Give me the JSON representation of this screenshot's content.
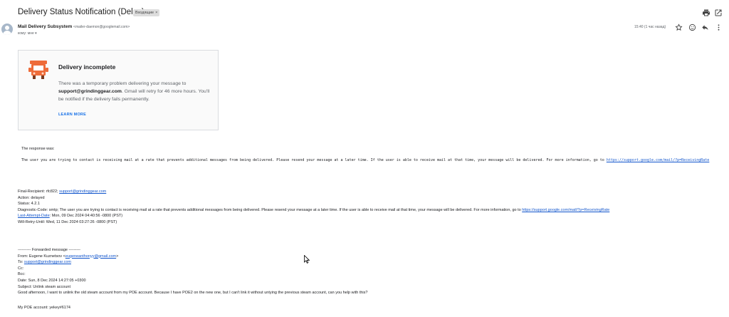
{
  "email": {
    "subject": "Delivery Status Notification (Delay)",
    "label": "Входящие",
    "label_close": "×",
    "sender_name": "Mail Delivery Subsystem",
    "sender_email": "<mailer-daemon@googlemail.com>",
    "to_line": "кому: мне",
    "time": "15:40 (1 час назад)"
  },
  "toolbar": {
    "print_icon": "print-icon",
    "open_new_icon": "open-in-new-window-icon",
    "star_icon": "star-icon",
    "emoji_icon": "emoji-icon",
    "reply_icon": "reply-icon",
    "more_icon": "more-vertical-icon"
  },
  "card": {
    "title": "Delivery incomplete",
    "text_before": "There was a temporary problem delivering your message to ",
    "recipient": "support@grindinggear.com",
    "text_after": ". Gmail will retry for 46 more hours. You'll be notified if the delivery fails permanently.",
    "learn_more": "LEARN MORE",
    "icon_color": "#ee6c3a"
  },
  "response": {
    "label": "The response was:",
    "text": "The user you are trying to contact is receiving mail at a rate that prevents additional messages from being delivered. Please resend your message at a later time. If the user is able to receive mail at that time, your message will be delivered. For more information, go to ",
    "link": "https://support.google.com/mail/?p=ReceivingRate"
  },
  "diagnostic": {
    "final_recipient_label": "Final-Recipient: rfc822; ",
    "final_recipient": "support@grindinggear.com",
    "action": "Action: delayed",
    "status": "Status: 4.2.1",
    "diag_code": "Diagnostic-Code: smtp; The user you are trying to contact is receiving mail at a rate that prevents additional messages from being delivered. Please resend your message at a later time. If the user is able to receive mail at that time, your message will be delivered. For more information, go to ",
    "diag_link": "https://support.google.com/mail/?p=ReceivingRate",
    "last_attempt_label": "Last-Attempt-Date",
    "last_attempt_value": ": Mon, 09 Dec 2024 04:40:56 -0800 (PST)",
    "will_retry": "Will-Retry-Until: Wed, 11 Dec 2024 03:27:26 -0800 (PST)"
  },
  "forwarded": {
    "header": "---------- Forwarded message ---------",
    "from_label": "From: Eugene Kuznetsov <",
    "from_email": "eugeneanthonyy@gmail.com",
    "from_end": ">",
    "to_label": "To: ",
    "to_email": "support@grindinggear.com",
    "cc": "Cc:",
    "bcc": "Bcc:",
    "date": "Date: Sun, 8 Dec 2024 14:27:05 +0300",
    "subject": "Subject: Unlink steam account",
    "body": "Good afternoon, I want to unlink the old steam account from my POE account. Because I have POE2 on the new one, but I can't link it without untying the previous steam account, can you help with this?"
  },
  "poe_account": "My POE account: yekey#6174"
}
